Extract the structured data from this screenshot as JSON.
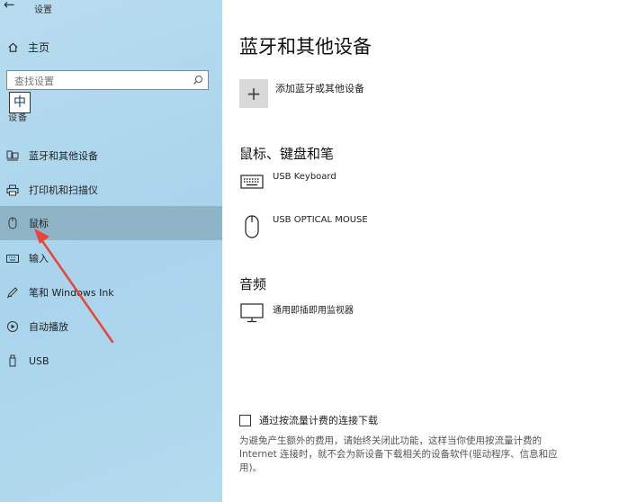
{
  "window": {
    "back_glyph": "←",
    "title": "设置"
  },
  "sidebar": {
    "home_label": "主页",
    "search_placeholder": "查找设置",
    "ime_indicator": "中",
    "section_label": "设备",
    "items": [
      {
        "label": "蓝牙和其他设备",
        "icon": "bluetooth-devices-icon"
      },
      {
        "label": "打印机和扫描仪",
        "icon": "printer-icon"
      },
      {
        "label": "鼠标",
        "icon": "mouse-icon",
        "selected": true
      },
      {
        "label": "输入",
        "icon": "keyboard-icon"
      },
      {
        "label": "笔和 Windows Ink",
        "icon": "pen-icon"
      },
      {
        "label": "自动播放",
        "icon": "autoplay-icon"
      },
      {
        "label": "USB",
        "icon": "usb-icon"
      }
    ]
  },
  "main": {
    "page_title": "蓝牙和其他设备",
    "add_button": {
      "glyph": "+",
      "label": "添加蓝牙或其他设备"
    },
    "sections": [
      {
        "heading": "鼠标、键盘和笔",
        "devices": [
          {
            "name": "USB Keyboard",
            "icon": "keyboard-icon"
          },
          {
            "name": "USB OPTICAL MOUSE",
            "icon": "mouse-icon"
          }
        ]
      },
      {
        "heading": "音频",
        "devices": [
          {
            "name": "通用即插即用监视器",
            "icon": "monitor-icon"
          }
        ]
      }
    ],
    "metered": {
      "checkbox_label": "通过按流量计费的连接下载",
      "checked": false,
      "description": "为避免产生额外的费用，请始终关闭此功能，这样当你使用按流量计费的 Internet 连接时，就不会为新设备下载相关的设备软件(驱动程序、信息和应用)。"
    }
  },
  "colors": {
    "sidebar_bg": "#b1d7ed",
    "selected_item_bg": "#8fb4c8",
    "annotation_arrow": "#e8463a"
  }
}
